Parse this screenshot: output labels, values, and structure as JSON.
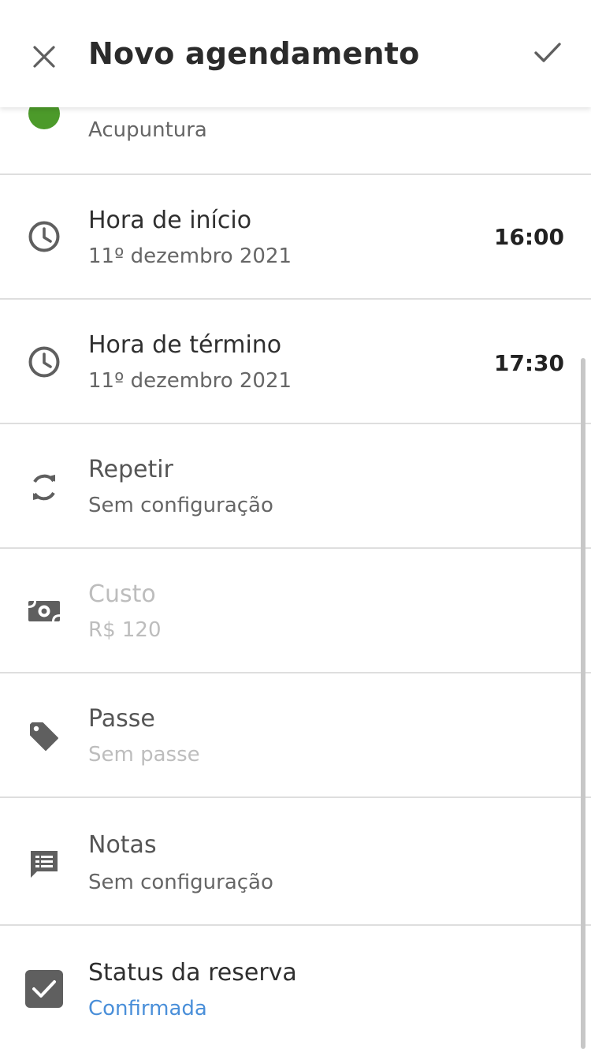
{
  "header": {
    "title": "Novo agendamento",
    "close_icon": "close-icon",
    "confirm_icon": "check-icon"
  },
  "rows": {
    "service": {
      "sub": "Acupuntura",
      "dot_color": "#4c9a2a"
    },
    "start": {
      "label": "Hora de início",
      "sub": "11º dezembro 2021",
      "value": "16:00",
      "icon": "clock-icon"
    },
    "end": {
      "label": "Hora de término",
      "sub": "11º dezembro 2021",
      "value": "17:30",
      "icon": "clock-icon"
    },
    "repeat": {
      "label": "Repetir",
      "sub": "Sem configuração",
      "icon": "repeat-icon"
    },
    "cost": {
      "label": "Custo",
      "sub": "R$ 120",
      "icon": "money-icon"
    },
    "pass": {
      "label": "Passe",
      "sub": "Sem passe",
      "icon": "tag-icon"
    },
    "notes": {
      "label": "Notas",
      "sub": "Sem configuração",
      "icon": "notes-icon"
    },
    "status": {
      "label": "Status da reserva",
      "sub": "Confirmada",
      "checked": true,
      "icon": "checkbox-icon",
      "accent": "#4a8fd9"
    }
  },
  "colors": {
    "icon": "#5f5f5f",
    "divider": "#dedede",
    "accent": "#4a8fd9",
    "service_dot": "#4c9a2a"
  }
}
